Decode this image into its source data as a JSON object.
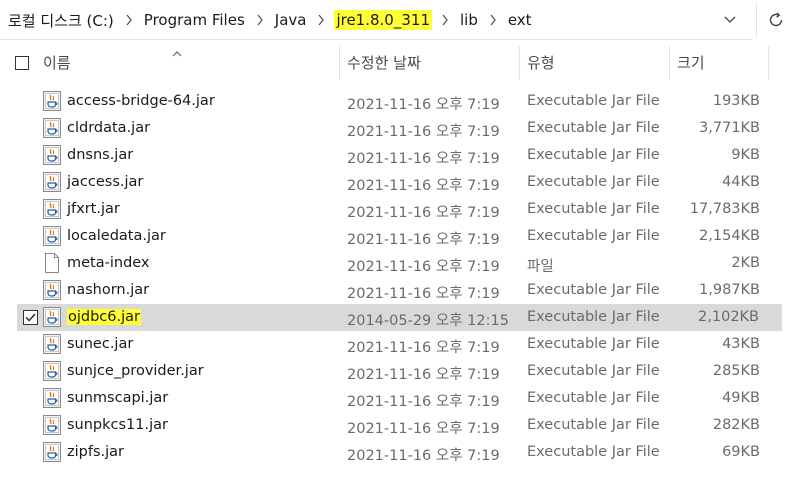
{
  "breadcrumb": {
    "items": [
      "로컬 디스크 (C:)",
      "Program Files",
      "Java",
      "jre1.8.0_311",
      "lib",
      "ext"
    ]
  },
  "columns": {
    "name": "이름",
    "date": "수정한 날짜",
    "type": "유형",
    "size": "크기"
  },
  "files": [
    {
      "name": "access-bridge-64.jar",
      "date": "2021-11-16 오후 7:19",
      "type": "Executable Jar File",
      "size": "193KB",
      "icon": "jar-icon"
    },
    {
      "name": "cldrdata.jar",
      "date": "2021-11-16 오후 7:19",
      "type": "Executable Jar File",
      "size": "3,771KB",
      "icon": "jar-icon"
    },
    {
      "name": "dnsns.jar",
      "date": "2021-11-16 오후 7:19",
      "type": "Executable Jar File",
      "size": "9KB",
      "icon": "jar-icon"
    },
    {
      "name": "jaccess.jar",
      "date": "2021-11-16 오후 7:19",
      "type": "Executable Jar File",
      "size": "44KB",
      "icon": "jar-icon"
    },
    {
      "name": "jfxrt.jar",
      "date": "2021-11-16 오후 7:19",
      "type": "Executable Jar File",
      "size": "17,783KB",
      "icon": "jar-icon"
    },
    {
      "name": "localedata.jar",
      "date": "2021-11-16 오후 7:19",
      "type": "Executable Jar File",
      "size": "2,154KB",
      "icon": "jar-icon"
    },
    {
      "name": "meta-index",
      "date": "2021-11-16 오후 7:19",
      "type": "파일",
      "size": "2KB",
      "icon": "file-icon"
    },
    {
      "name": "nashorn.jar",
      "date": "2021-11-16 오후 7:19",
      "type": "Executable Jar File",
      "size": "1,987KB",
      "icon": "jar-icon"
    },
    {
      "name": "ojdbc6.jar",
      "date": "2014-05-29 오후 12:15",
      "type": "Executable Jar File",
      "size": "2,102KB",
      "icon": "jar-icon",
      "selected": true
    },
    {
      "name": "sunec.jar",
      "date": "2021-11-16 오후 7:19",
      "type": "Executable Jar File",
      "size": "43KB",
      "icon": "jar-icon"
    },
    {
      "name": "sunjce_provider.jar",
      "date": "2021-11-16 오후 7:19",
      "type": "Executable Jar File",
      "size": "285KB",
      "icon": "jar-icon"
    },
    {
      "name": "sunmscapi.jar",
      "date": "2021-11-16 오후 7:19",
      "type": "Executable Jar File",
      "size": "49KB",
      "icon": "jar-icon"
    },
    {
      "name": "sunpkcs11.jar",
      "date": "2021-11-16 오후 7:19",
      "type": "Executable Jar File",
      "size": "282KB",
      "icon": "jar-icon"
    },
    {
      "name": "zipfs.jar",
      "date": "2021-11-16 오후 7:19",
      "type": "Executable Jar File",
      "size": "69KB",
      "icon": "jar-icon"
    }
  ],
  "colors": {
    "highlight": "#ffff33",
    "selected_row": "#d9d9d9"
  }
}
